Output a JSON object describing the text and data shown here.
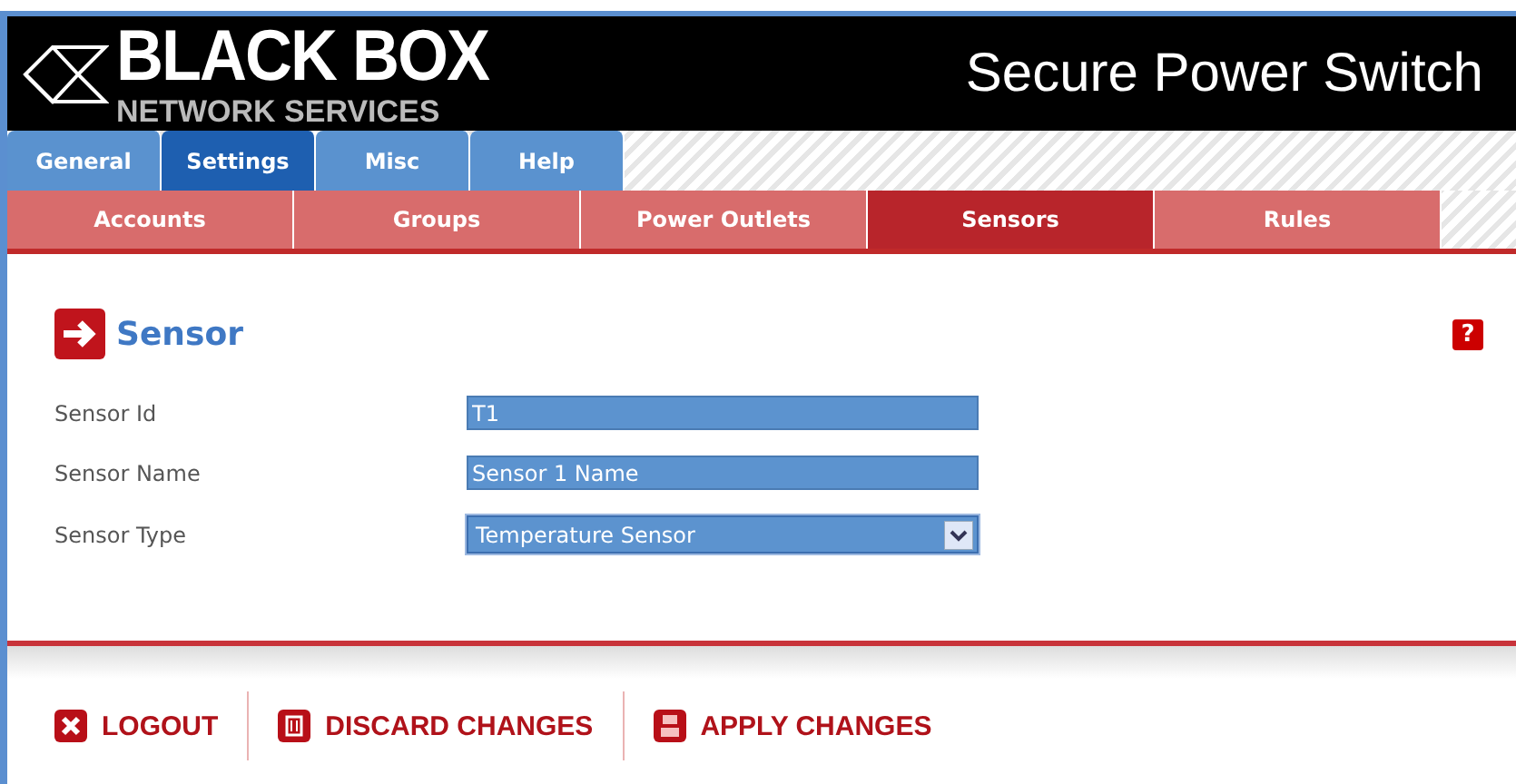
{
  "logo": {
    "name": "BLACK BOX",
    "subtitle": "NETWORK SERVICES"
  },
  "product_title": "Secure Power Switch",
  "tabs": [
    {
      "label": "General",
      "selected": false
    },
    {
      "label": "Settings",
      "selected": true
    },
    {
      "label": "Misc",
      "selected": false
    },
    {
      "label": "Help",
      "selected": false
    }
  ],
  "subtabs": [
    {
      "label": "Accounts",
      "selected": false
    },
    {
      "label": "Groups",
      "selected": false
    },
    {
      "label": "Power Outlets",
      "selected": false
    },
    {
      "label": "Sensors",
      "selected": true
    },
    {
      "label": "Rules",
      "selected": false
    }
  ],
  "section_title": "Sensor",
  "help_icon": "?",
  "fields": [
    {
      "kind": "text",
      "label": "Sensor Id",
      "value": "T1"
    },
    {
      "kind": "text",
      "label": "Sensor Name",
      "value": "Sensor 1 Name"
    },
    {
      "kind": "select",
      "label": "Sensor Type",
      "value": "Temperature Sensor"
    }
  ],
  "actions": [
    {
      "kind": "logout",
      "label": "LOGOUT"
    },
    {
      "kind": "discard",
      "label": "DISCARD CHANGES"
    },
    {
      "kind": "apply",
      "label": "APPLY CHANGES"
    }
  ]
}
